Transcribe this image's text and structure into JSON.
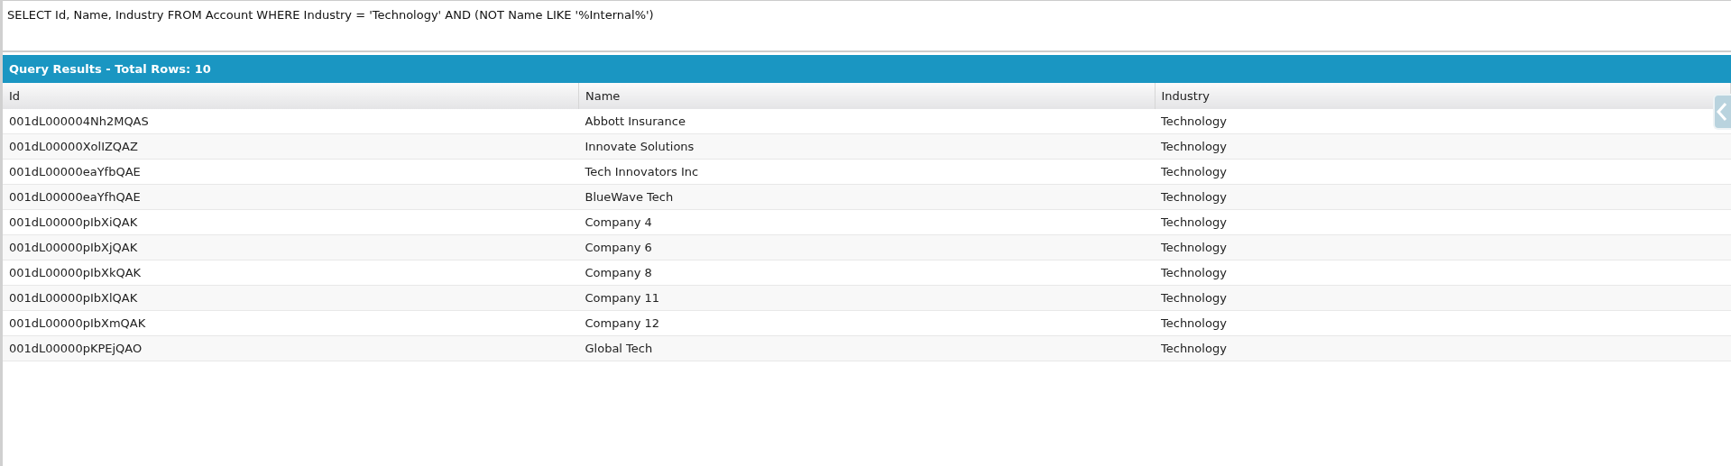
{
  "query": {
    "value": "SELECT Id, Name, Industry FROM Account WHERE Industry = 'Technology' AND (NOT Name LIKE '%Internal%')"
  },
  "results": {
    "title": "Query Results - Total Rows: 10",
    "columns": [
      "Id",
      "Name",
      "Industry"
    ],
    "rows": [
      [
        "001dL000004Nh2MQAS",
        "Abbott Insurance",
        "Technology"
      ],
      [
        "001dL00000XolIZQAZ",
        "Innovate Solutions",
        "Technology"
      ],
      [
        "001dL00000eaYfbQAE",
        "Tech Innovators Inc",
        "Technology"
      ],
      [
        "001dL00000eaYfhQAE",
        "BlueWave Tech",
        "Technology"
      ],
      [
        "001dL00000pIbXiQAK",
        "Company 4",
        "Technology"
      ],
      [
        "001dL00000pIbXjQAK",
        "Company 6",
        "Technology"
      ],
      [
        "001dL00000pIbXkQAK",
        "Company 8",
        "Technology"
      ],
      [
        "001dL00000pIbXlQAK",
        "Company 11",
        "Technology"
      ],
      [
        "001dL00000pIbXmQAK",
        "Company 12",
        "Technology"
      ],
      [
        "001dL00000pKPEjQAO",
        "Global Tech",
        "Technology"
      ]
    ]
  }
}
